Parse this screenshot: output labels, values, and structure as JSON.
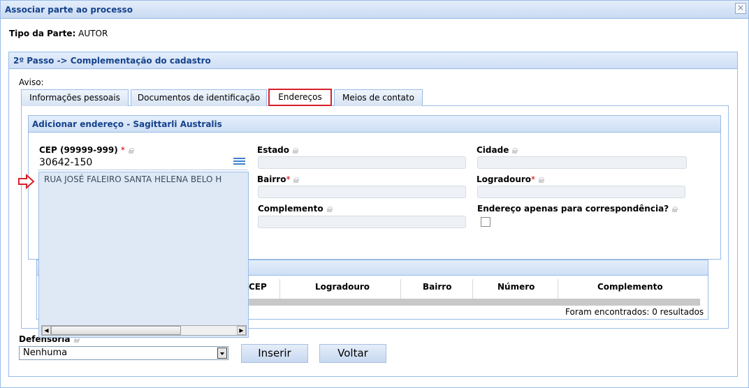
{
  "window": {
    "title": "Associar parte ao processo",
    "close_glyph": "×"
  },
  "tipo_parte": {
    "label": "Tipo da Parte:",
    "value": "AUTOR"
  },
  "step": {
    "title": "2º Passo -> Complementação do cadastro"
  },
  "aviso": "Aviso:",
  "tabs": [
    {
      "label": "Informações pessoais"
    },
    {
      "label": "Documentos de identificação"
    },
    {
      "label": "Endereços"
    },
    {
      "label": "Meios de contato"
    }
  ],
  "address_panel": {
    "title": "Adicionar endereço - Sagittarli Australis",
    "cep": {
      "label": "CEP (99999-999)",
      "value": "30642-150"
    },
    "estado": {
      "label": "Estado"
    },
    "cidade": {
      "label": "Cidade"
    },
    "bairro": {
      "label": "Bairro"
    },
    "logradouro": {
      "label": "Logradouro"
    },
    "complemento": {
      "label": "Complemento"
    },
    "correspondencia": {
      "label": "Endereço apenas para correspondência?"
    },
    "required_mark": "*"
  },
  "dropdown": {
    "row": "RUA JOSÉ FALEIRO   SANTA HELENA   BELO H"
  },
  "grid": {
    "columns": [
      "CEP",
      "Logradouro",
      "Bairro",
      "Número",
      "Complemento"
    ],
    "results": "Foram encontrados: 0 resultados"
  },
  "defensoria": {
    "label": "Defensoria",
    "value": "Nenhuma"
  },
  "buttons": {
    "inserir": "Inserir",
    "voltar": "Voltar"
  },
  "colors": {
    "accent": "#99bbe8",
    "header_text": "#15428b",
    "highlight": "#d8202b",
    "required": "#cc0000"
  }
}
